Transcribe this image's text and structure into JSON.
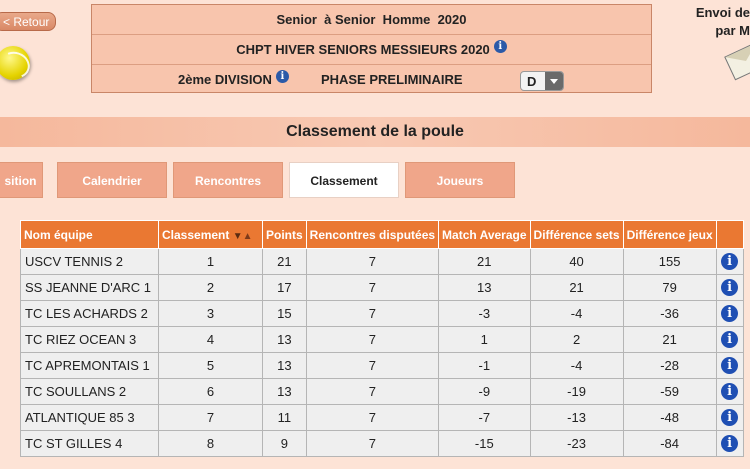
{
  "header": {
    "back_label": "< Retour",
    "line1": "Senior  à Senior  Homme  2020",
    "line2": "CHPT HIVER SENIORS MESSIEURS 2020",
    "division": "2ème DIVISION",
    "phase": "PHASE PRELIMINAIRE",
    "group_select": "D",
    "envoi_line1": "Envoi de",
    "envoi_line2": "par M"
  },
  "section_title": "Classement de la poule",
  "tabs": [
    {
      "label": "sition"
    },
    {
      "label": "Calendrier"
    },
    {
      "label": "Rencontres"
    },
    {
      "label": "Classement"
    },
    {
      "label": "Joueurs"
    }
  ],
  "table": {
    "columns": [
      "Nom équipe",
      "Classement",
      "Points",
      "Rencontres disputées",
      "Match Average",
      "Différence sets",
      "Différence jeux"
    ],
    "rows": [
      [
        "USCV TENNIS 2",
        "1",
        "21",
        "7",
        "21",
        "40",
        "155"
      ],
      [
        "SS JEANNE D'ARC 1",
        "2",
        "17",
        "7",
        "13",
        "21",
        "79"
      ],
      [
        "TC LES ACHARDS 2",
        "3",
        "15",
        "7",
        "-3",
        "-4",
        "-36"
      ],
      [
        "TC RIEZ OCEAN 3",
        "4",
        "13",
        "7",
        "1",
        "2",
        "21"
      ],
      [
        "TC APREMONTAIS 1",
        "5",
        "13",
        "7",
        "-1",
        "-4",
        "-28"
      ],
      [
        "TC SOULLANS 2",
        "6",
        "13",
        "7",
        "-9",
        "-19",
        "-59"
      ],
      [
        "ATLANTIQUE 85 3",
        "7",
        "11",
        "7",
        "-7",
        "-13",
        "-48"
      ],
      [
        "TC ST GILLES 4",
        "8",
        "9",
        "7",
        "-15",
        "-23",
        "-84"
      ]
    ]
  },
  "icons": {
    "info": "info-icon",
    "sort": "sort-arrows-icon",
    "ball": "tennis-ball-icon",
    "envelope": "envelope-icon"
  }
}
